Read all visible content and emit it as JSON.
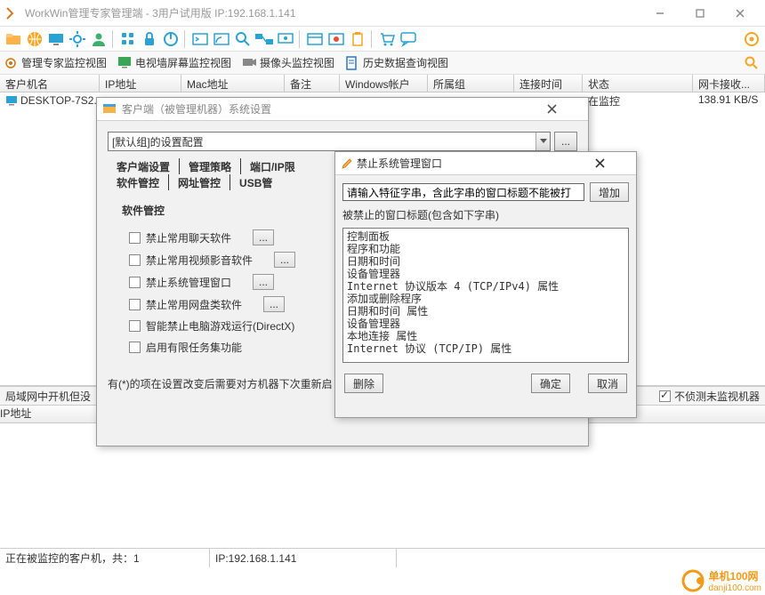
{
  "window": {
    "title": "WorkWin管理专家管理端 - 3用户试用版 IP:192.168.1.141"
  },
  "view_tabs": [
    "管理专家监控视图",
    "电视墙屏幕监控视图",
    "摄像头监控视图",
    "历史数据查询视图"
  ],
  "grid": {
    "cols": {
      "host": "客户机名",
      "ip": "IP地址",
      "mac": "Mac地址",
      "remark": "备注",
      "winuser": "Windows帐户",
      "group": "所属组",
      "conn": "连接时间",
      "status": "状态",
      "netcard": "网卡接收..."
    },
    "row": {
      "host": "DESKTOP-7S2...",
      "status": "在监控",
      "speed": "138.91 KB/S"
    }
  },
  "lan": {
    "title": "局域网中开机但没",
    "unmonitor_label": "不侦测未监视机器",
    "ip_col": "IP地址"
  },
  "status": {
    "text": "正在被监控的客户机，共：1",
    "ip": "IP:192.168.1.141"
  },
  "watermark": {
    "brand": "单机100网",
    "url": "danji100.com"
  },
  "dlg1": {
    "title": "客户端（被管理机器）系统设置",
    "combo_value": "[默认组]的设置配置",
    "tabs_row1": [
      "客户端设置",
      "管理策略",
      "端口/IP限"
    ],
    "tabs_row2": [
      "软件管控",
      "网址管控",
      "USB管"
    ],
    "section": "软件管控",
    "checks": [
      "禁止常用聊天软件",
      "禁止常用视频影音软件",
      "禁止系统管理窗口",
      "禁止常用网盘类软件",
      "智能禁止电脑游戏运行(DirectX)",
      "启用有限任务集功能"
    ],
    "note": "有(*)的项在设置改变后需要对方机器下次重新启"
  },
  "dlg2": {
    "title": "禁止系统管理窗口",
    "input_placeholder": "请输入特征字串，含此字串的窗口标题不能被打",
    "add": "增加",
    "list_label": "被禁止的窗口标题(包含如下字串)",
    "list_text": "控制面板\n程序和功能\n日期和时间\n设备管理器\nInternet 协议版本 4 (TCP/IPv4) 属性\n添加或删除程序\n日期和时间 属性\n设备管理器\n本地连接 属性\nInternet 协议 (TCP/IP) 属性",
    "delete": "删除",
    "ok": "确定",
    "cancel": "取消"
  }
}
